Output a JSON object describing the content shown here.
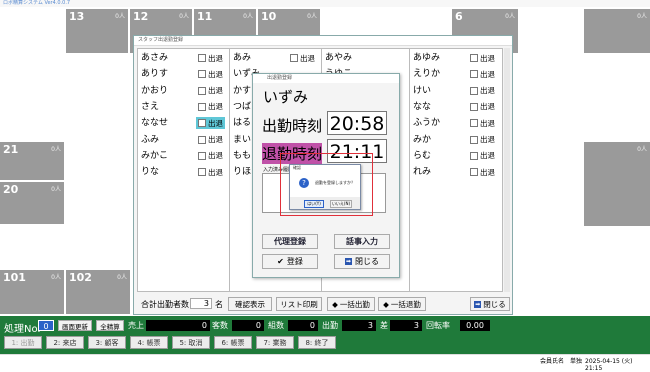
{
  "app": {
    "title": "ロボ精算システム Ver4.0.0.7"
  },
  "tiles": {
    "t13": {
      "num": "13",
      "count": "0人"
    },
    "t12": {
      "num": "12",
      "count": "0人"
    },
    "t11": {
      "num": "11",
      "count": "0人"
    },
    "t10": {
      "num": "10",
      "count": "0人"
    },
    "t6": {
      "num": "6",
      "count": "0人"
    },
    "t21": {
      "num": "21",
      "count": "0人"
    },
    "t20": {
      "num": "20",
      "count": "0人"
    },
    "t101": {
      "num": "101",
      "count": "0人"
    },
    "t102": {
      "num": "102",
      "count": "0人"
    },
    "tr1": {
      "count": "0人"
    },
    "tr2": {
      "count": "0人"
    }
  },
  "staff_window": {
    "title": "スタッフ出退勤登録",
    "col1": [
      {
        "name": "あさみ",
        "status": "出退",
        "on": false
      },
      {
        "name": "ありす",
        "status": "出退",
        "on": false
      },
      {
        "name": "かおり",
        "status": "出退",
        "on": false
      },
      {
        "name": "さえ",
        "status": "出退",
        "on": false
      },
      {
        "name": "ななせ",
        "status": "出退",
        "on": true
      },
      {
        "name": "ふみ",
        "status": "出退",
        "on": false
      },
      {
        "name": "みかこ",
        "status": "出退",
        "on": false
      },
      {
        "name": "りな",
        "status": "出退",
        "on": false
      }
    ],
    "col2": [
      {
        "name": "あみ"
      },
      {
        "name": "いずみ"
      },
      {
        "name": "かす"
      },
      {
        "name": "つば"
      },
      {
        "name": "はる"
      },
      {
        "name": "まい"
      },
      {
        "name": "もも"
      },
      {
        "name": "りほ"
      }
    ],
    "col2_status": [
      {
        "status": "出退"
      },
      {
        "status": "出退"
      },
      {
        "status": "出退"
      },
      {
        "status": "出退"
      },
      {
        "status": "出退"
      },
      {
        "status": "出退"
      },
      {
        "status": "出退"
      },
      {
        "status": "出退"
      }
    ],
    "col3": [
      {
        "name": "あやみ"
      },
      {
        "name": "うゆこ"
      }
    ],
    "col4": [
      {
        "name": "あゆみ",
        "status": "出退",
        "on": false
      },
      {
        "name": "えりか",
        "status": "出退",
        "on": false
      },
      {
        "name": "けい",
        "status": "出退",
        "on": false
      },
      {
        "name": "なな",
        "status": "出退",
        "on": false
      },
      {
        "name": "ふうか",
        "status": "出退",
        "on": false
      },
      {
        "name": "みか",
        "status": "出退",
        "on": false
      },
      {
        "name": "らむ",
        "status": "出退",
        "on": false
      },
      {
        "name": "れみ",
        "status": "出退",
        "on": false
      }
    ],
    "total_label": "合計出勤者数",
    "total_value": "3",
    "total_unit": "名",
    "confirm_btn": "確認表示",
    "list_print_btn": "リスト印刷",
    "bulk_in_btn": "一括出勤",
    "bulk_out_btn": "一括退勤",
    "close_btn": "閉じる"
  },
  "detail": {
    "title": "出退勤登録",
    "name": "いずみ",
    "in_label": "出勤時刻",
    "in_time": "20:58",
    "out_label": "退勤時刻",
    "out_time": "21:11",
    "input_label": "入力済み履歴",
    "proxy_btn": "代理登録",
    "diary_btn": "話事入力",
    "register_btn": "登録",
    "close_btn": "閉じる"
  },
  "confirm": {
    "title": "確認",
    "message": "退勤を登録しますか？",
    "yes": "はい(Y)",
    "no": "いいえ(N)"
  },
  "bottom": {
    "proc_label": "処理No.",
    "proc_value": "0",
    "screen_update": "画面更新",
    "total_calc": "全精算",
    "sales_label": "売上",
    "sales_value": "0",
    "guests_label": "客数",
    "guests_value": "0",
    "groups_label": "組数",
    "groups_value": "0",
    "attend_label": "出勤",
    "attend_value": "3",
    "diff_label": "差",
    "diff_value": "3",
    "turnover_label": "回転率",
    "turnover_value": "0.00",
    "fkeys": [
      "1: 出勤",
      "2: 来店",
      "3: 顧客",
      "4: 帳票",
      "5: 取消",
      "6: 帳票",
      "7: 業務",
      "8: 終了"
    ]
  },
  "status_bar": {
    "user": "会員氏名",
    "store": "単独",
    "datetime": "2025-04-15 (火) 21:15"
  }
}
